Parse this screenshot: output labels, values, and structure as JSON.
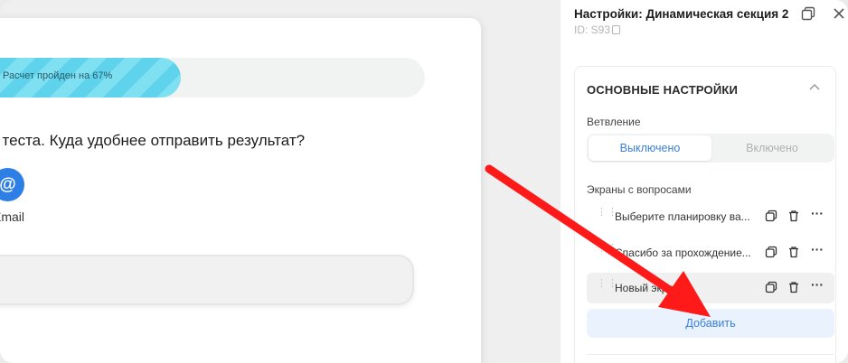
{
  "canvas": {
    "progress_text": "Расчет пройден на 67%",
    "progress_fraction": 0.47,
    "question": "ение теста. Куда удобнее отправить результат?",
    "contact_option": {
      "icon": "at-sign-icon",
      "symbol": "@",
      "label": "Email"
    }
  },
  "panel": {
    "title": "Настройки: Динамическая секция 2",
    "id_text": "ID: S93",
    "section": {
      "heading": "ОСНОВНЫЕ НАСТРОЙКИ",
      "branching_label": "Ветвление",
      "toggle": {
        "off_label": "Выключено",
        "on_label": "Включено",
        "selected": "off_label"
      },
      "screens_label": "Экраны с вопросами",
      "screens": [
        {
          "label": "Выберите планировку ва..."
        },
        {
          "label": "Спасибо за прохождение..."
        },
        {
          "label": "Новый экран"
        }
      ],
      "add_label": "Добавить"
    }
  },
  "colors": {
    "accent": "#3b7fd8",
    "progress": "#5fd3ec",
    "annotation_arrow": "#ff1a1a"
  }
}
